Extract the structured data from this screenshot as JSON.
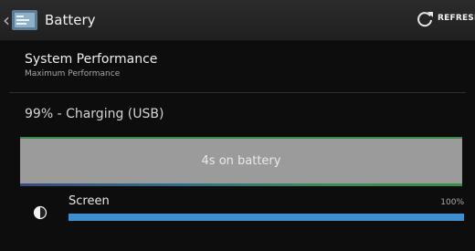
{
  "action_bar": {
    "title": "Battery",
    "refresh_label": "REFRESH"
  },
  "performance": {
    "title": "System Performance",
    "subtitle": "Maximum Performance"
  },
  "status": {
    "charge_text": "99% - Charging (USB)"
  },
  "graph": {
    "label": "4s on battery"
  },
  "usage": [
    {
      "label": "Screen",
      "percent_text": "100%",
      "fraction": 1.0,
      "icon": "brightness-icon"
    }
  ],
  "colors": {
    "graph_bg": "#9b9b9b",
    "bar_fill": "#3d8fcf",
    "graph_top_line": "#3a8a4c"
  }
}
